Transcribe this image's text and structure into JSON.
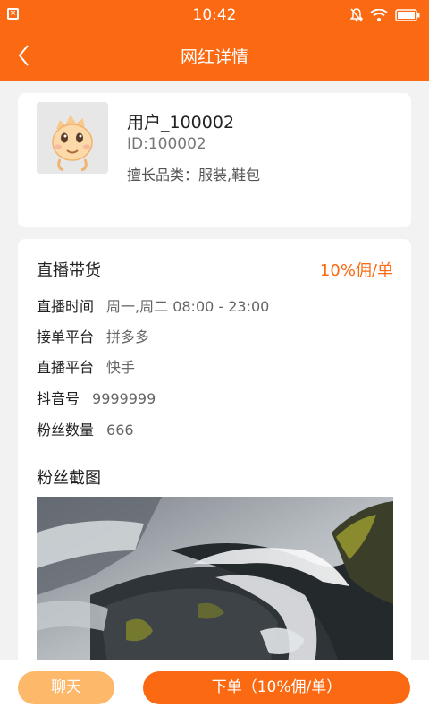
{
  "status_bar": {
    "time": "10:42",
    "notification_icon": "x-notification-icon"
  },
  "header": {
    "title": "网红详情",
    "back_icon": "chevron-left-icon"
  },
  "profile": {
    "username": "用户_100002",
    "id_text": "ID:100002",
    "categories_label": "擅长品类：",
    "categories_value": "服装,鞋包"
  },
  "details": {
    "section_title": "直播带货",
    "commission": "10%佣/单",
    "rows": [
      {
        "label": "直播时间",
        "value": "周一,周二 08:00 - 23:00"
      },
      {
        "label": "接单平台",
        "value": "拼多多"
      },
      {
        "label": "直播平台",
        "value": "快手"
      },
      {
        "label": "抖音号",
        "value": "9999999"
      },
      {
        "label": "粉丝数量",
        "value": "666"
      }
    ],
    "screenshots_title": "粉丝截图"
  },
  "actions": {
    "chat_label": "聊天",
    "order_label": "下单（10%佣/单）"
  },
  "colors": {
    "accent": "#fb6a12",
    "chat_button": "#fdb86a"
  }
}
